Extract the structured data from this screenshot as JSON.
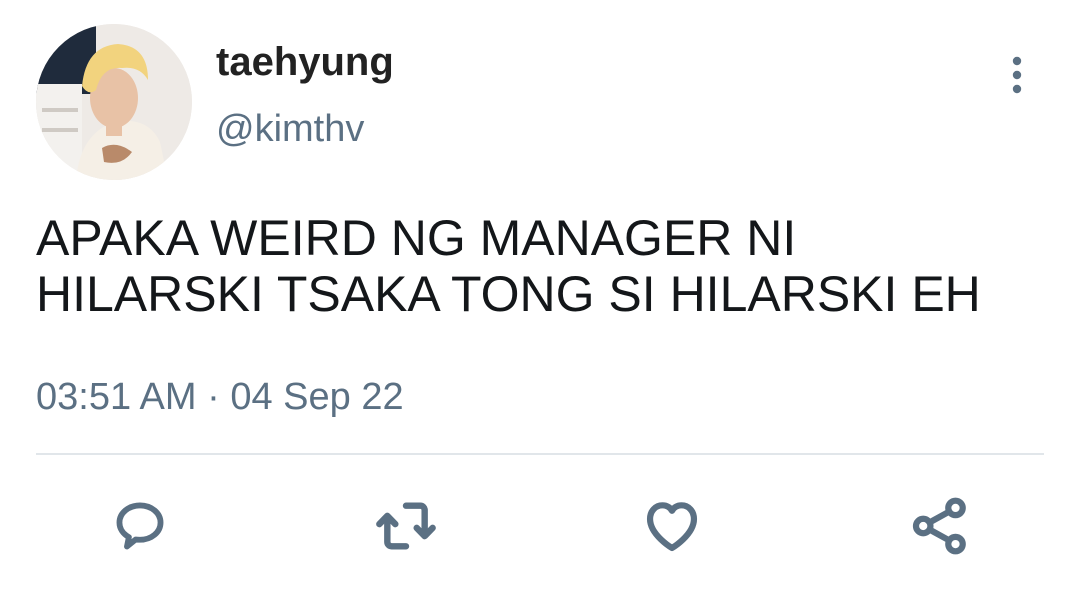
{
  "user": {
    "display_name": "taehyung",
    "handle": "@kimthv"
  },
  "tweet": {
    "lines": [
      "APAKA WEIRD NG MANAGER NI",
      "HILARSKI TSAKA TONG SI HILARSKI EH"
    ],
    "time": "03:51 AM",
    "separator": "·",
    "date": "04 Sep 22"
  },
  "icons": {
    "more": "more-vertical-icon",
    "reply": "reply-icon",
    "retweet": "retweet-icon",
    "like": "heart-icon",
    "share": "share-icon"
  },
  "colors": {
    "text": "#14171a",
    "secondary": "#5b7083",
    "divider": "#e1e6ea"
  }
}
